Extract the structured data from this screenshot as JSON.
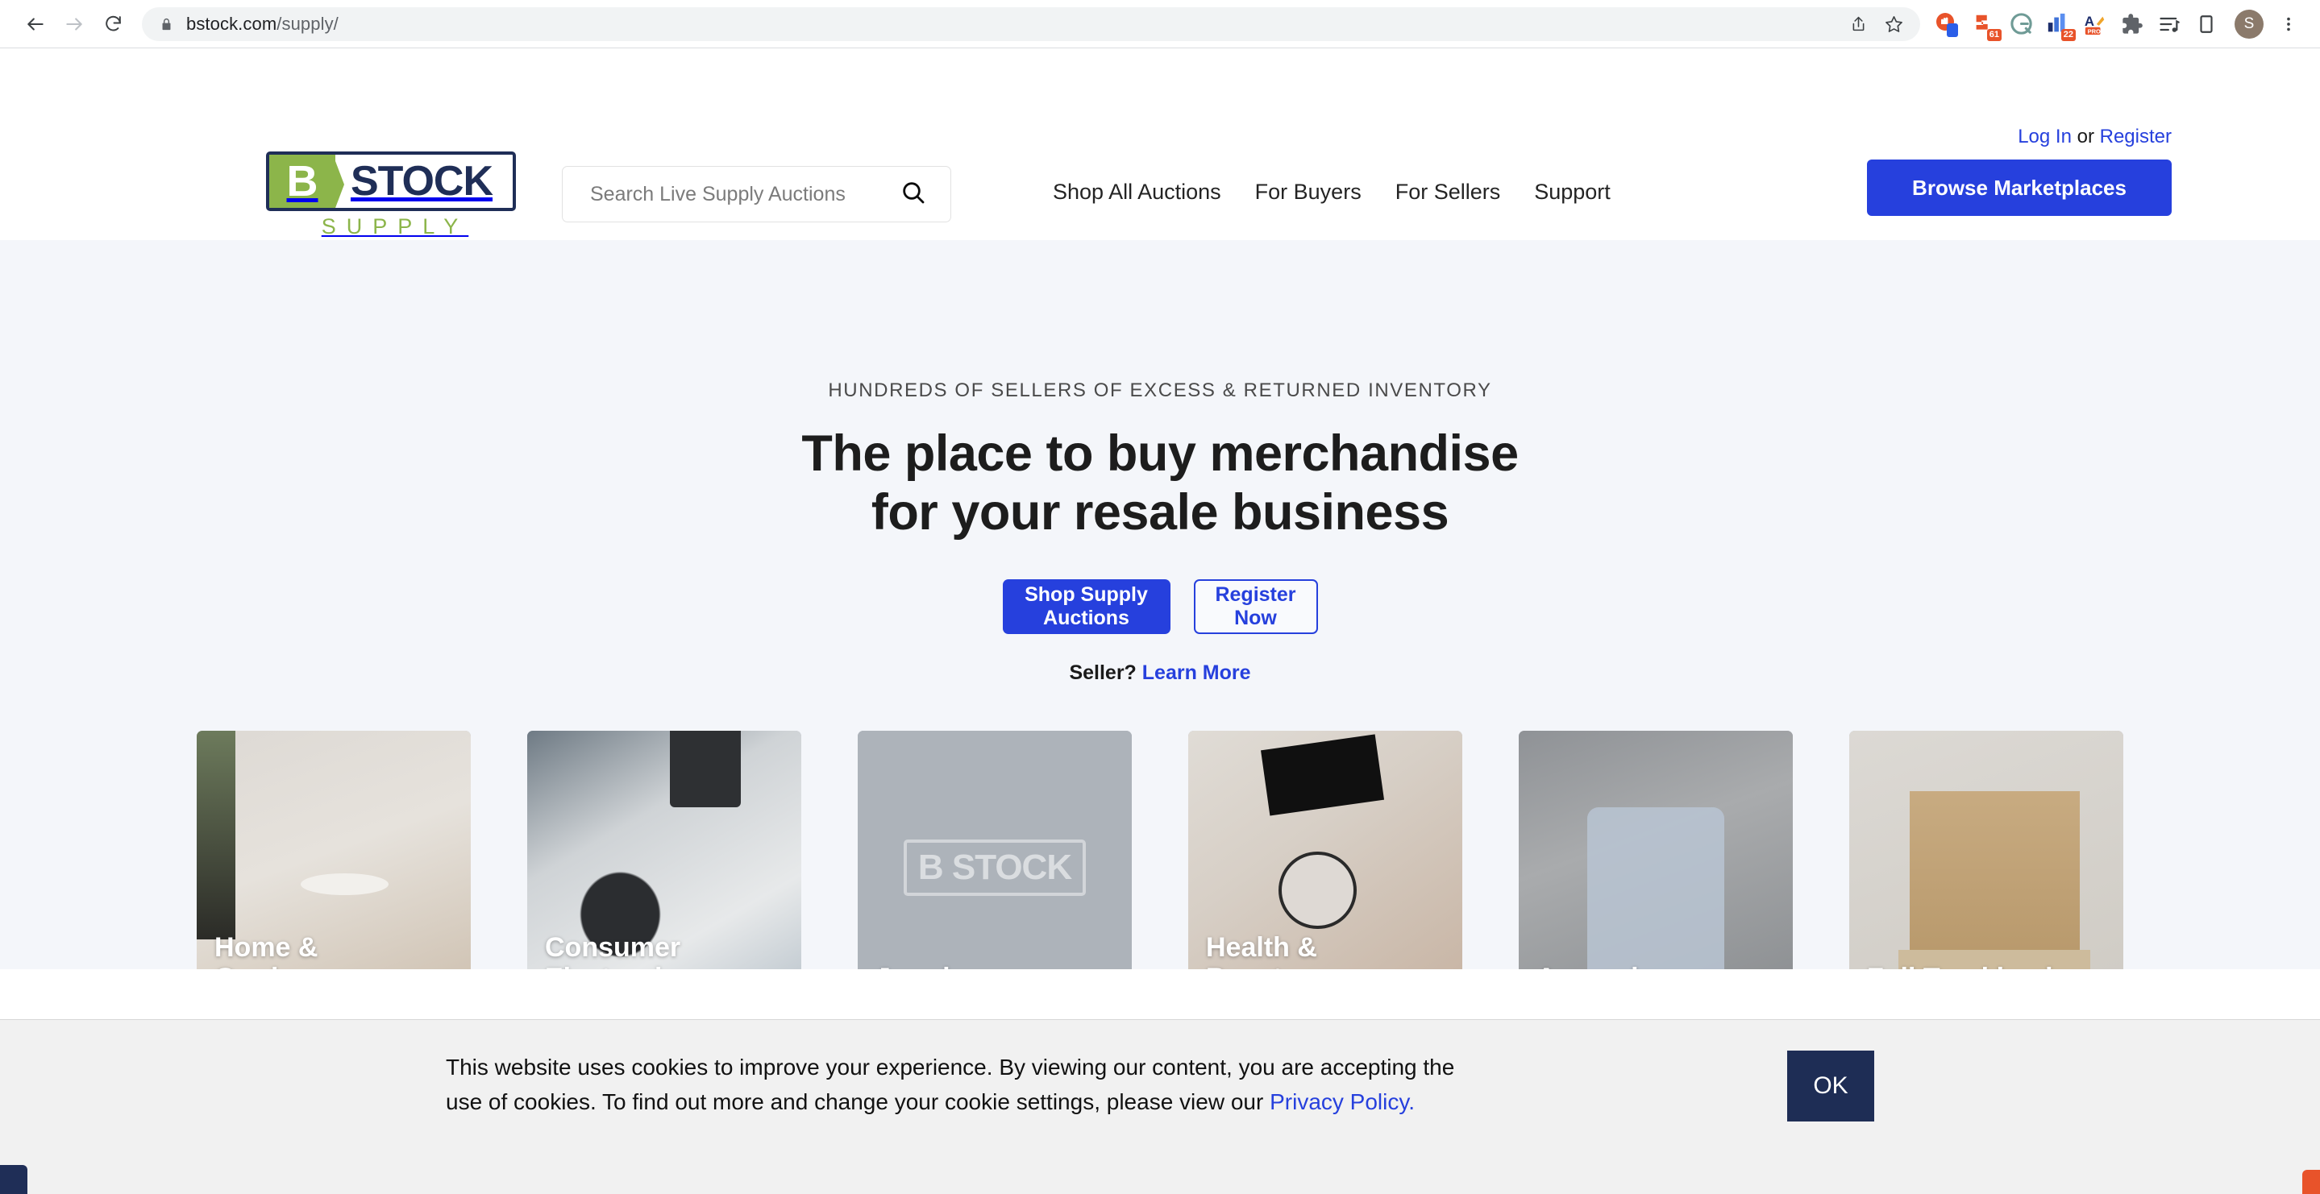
{
  "browser": {
    "url_domain": "bstock.com",
    "url_path": "/supply/",
    "back_icon": "back-arrow-icon",
    "forward_icon": "forward-arrow-icon",
    "reload_icon": "reload-icon",
    "lock_icon": "lock-icon",
    "share_icon": "share-icon",
    "bookmark_icon": "star-icon",
    "extensions": [
      {
        "name": "honey-extension-icon",
        "badge": ""
      },
      {
        "name": "adblock-extension-icon",
        "badge": "61"
      },
      {
        "name": "grammarly-extension-icon",
        "badge": ""
      },
      {
        "name": "analytics-extension-icon",
        "badge": "22"
      },
      {
        "name": "pro-extension-icon",
        "badge": ""
      },
      {
        "name": "puzzle-extensions-icon",
        "badge": ""
      },
      {
        "name": "media-list-icon",
        "badge": ""
      },
      {
        "name": "reading-list-icon",
        "badge": ""
      }
    ],
    "profile_initial": "S",
    "menu_icon": "kebab-menu-icon"
  },
  "header": {
    "logo": {
      "mark": "B",
      "word": "STOCK",
      "sub": "SUPPLY"
    },
    "search": {
      "placeholder": "Search Live Supply Auctions",
      "value": "",
      "icon": "search-icon"
    },
    "nav": [
      {
        "label": "Shop All Auctions"
      },
      {
        "label": "For Buyers"
      },
      {
        "label": "For Sellers"
      },
      {
        "label": "Support"
      }
    ],
    "auth": {
      "login": "Log In",
      "separator": " or ",
      "register": "Register"
    },
    "browse_button": "Browse Marketplaces"
  },
  "hero": {
    "eyebrow": "HUNDREDS OF SELLERS OF EXCESS & RETURNED INVENTORY",
    "title_line1": "The place to buy merchandise",
    "title_line2": "for your resale business",
    "primary_cta": "Shop Supply Auctions",
    "secondary_cta": "Register Now",
    "seller_prefix": "Seller? ",
    "seller_link": "Learn More",
    "cards": [
      {
        "label_line1": "Home &",
        "label_line2": "Garden",
        "image": "home-garden-photo"
      },
      {
        "label_line1": "Consumer",
        "label_line2": "Electronics",
        "image": "consumer-electronics-photo"
      },
      {
        "label_line1": "",
        "label_line2": "Jewelry",
        "image": "placeholder-bstock-watermark"
      },
      {
        "label_line1": "Health &",
        "label_line2": "Beauty",
        "image": "health-beauty-photo"
      },
      {
        "label_line1": "",
        "label_line2": "Apparel",
        "image": "apparel-photo"
      },
      {
        "label_line1": "",
        "label_line2": "Full Truckloads",
        "image": "pallet-photo"
      }
    ],
    "watermark": {
      "mark": "B",
      "word": "STOCK"
    }
  },
  "cookie": {
    "line1": "This website uses cookies to improve your experience. By viewing our content, you are accepting the",
    "line2_prefix": "use of cookies. To find out more and change your cookie settings, please view our ",
    "policy_link": "Privacy Policy.",
    "ok_label": "OK"
  },
  "colors": {
    "brand_blue": "#2640dd",
    "brand_navy": "#1f2e57",
    "brand_green": "#8cb54a",
    "hero_bg": "#f4f6fa",
    "cookie_bg": "#f1f1f1",
    "cookie_ok_bg": "#1e2d55"
  }
}
